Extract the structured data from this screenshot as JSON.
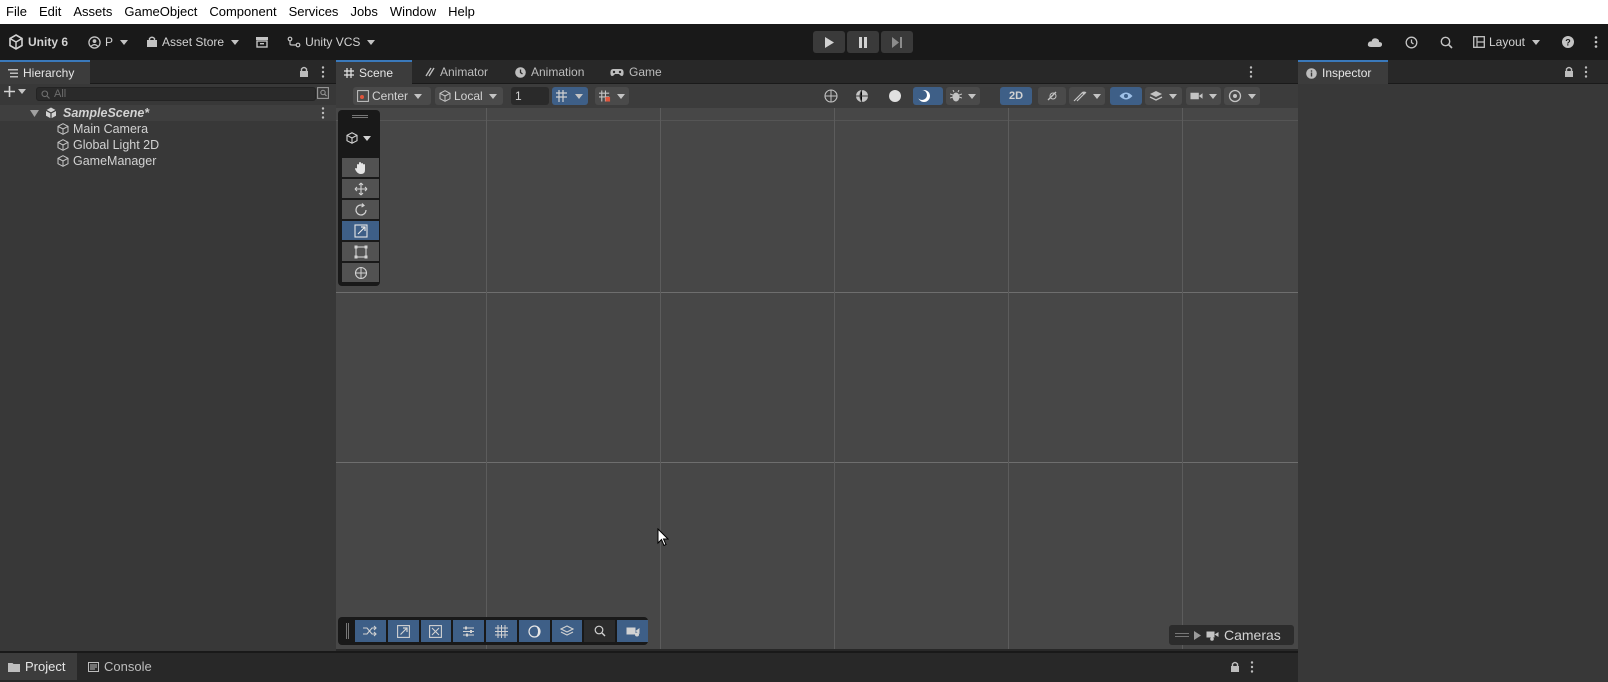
{
  "menu": [
    "File",
    "Edit",
    "Assets",
    "GameObject",
    "Component",
    "Services",
    "Jobs",
    "Window",
    "Help"
  ],
  "toolbar": {
    "unity_label": "Unity 6",
    "account_label": "P",
    "asset_store_label": "Asset Store",
    "vcs_label": "Unity VCS",
    "layout_label": "Layout"
  },
  "hierarchy": {
    "tab_label": "Hierarchy",
    "search_placeholder": "All",
    "scene_name": "SampleScene*",
    "items": [
      "Main Camera",
      "Global Light 2D",
      "GameManager"
    ]
  },
  "scene_tabs": [
    {
      "label": "Scene",
      "icon": "grid-icon"
    },
    {
      "label": "Animator",
      "icon": "animator-icon"
    },
    {
      "label": "Animation",
      "icon": "clock-icon"
    },
    {
      "label": "Game",
      "icon": "gamepad-icon"
    }
  ],
  "scene_toolbar": {
    "pivot_label": "Center",
    "space_label": "Local",
    "snap_value": "1",
    "mode_2d_label": "2D"
  },
  "scene_overlay": {
    "cameras_label": "Cameras"
  },
  "inspector": {
    "tab_label": "Inspector"
  },
  "bottom_tabs": [
    "Project",
    "Console"
  ],
  "colors": {
    "accent_blue": "#3e5f87",
    "tab_highlight": "#3a79bb",
    "scene_bg": "#474747",
    "panel_bg": "#383838"
  }
}
